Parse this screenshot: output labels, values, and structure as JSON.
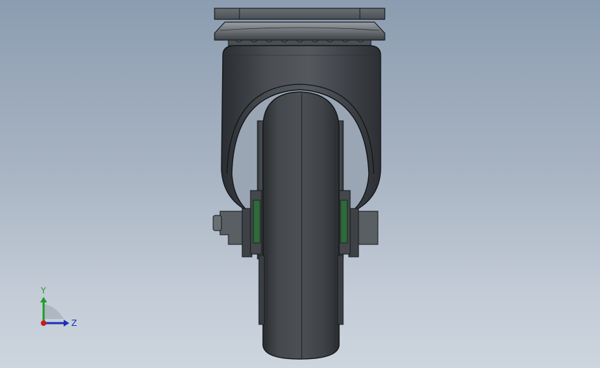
{
  "viewport": {
    "background_top": "#8c9db1",
    "background_bottom": "#cdd5de"
  },
  "model": {
    "name": "swivel-caster-wheel",
    "body_color": "#3c4044",
    "edge_color": "#1a1c1e",
    "bearing_accent": "#2e6a3a"
  },
  "triad": {
    "y_label": "Y",
    "z_label": "Z",
    "y_color": "#1e9e2a",
    "z_color": "#1c2fb8",
    "x_color": "#c41e1e"
  }
}
